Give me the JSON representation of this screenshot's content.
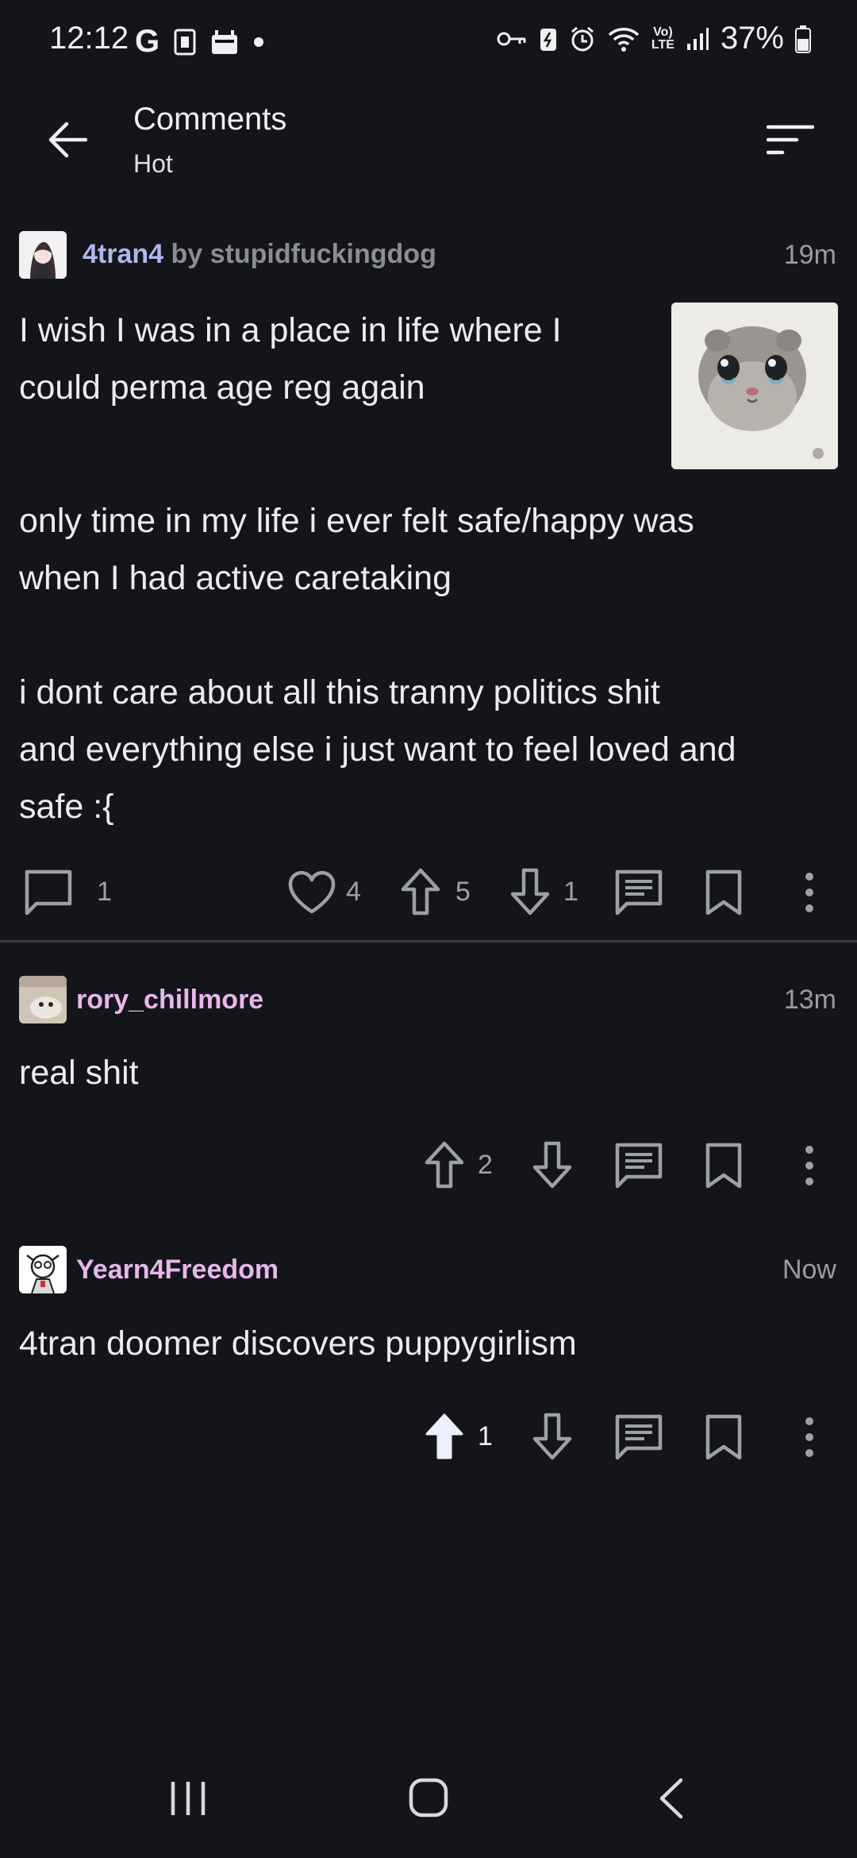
{
  "status_bar": {
    "time": "12:12",
    "battery": "37%"
  },
  "header": {
    "title": "Comments",
    "subtitle": "Hot"
  },
  "post": {
    "community": "4tran4",
    "by_label": "by",
    "author": "stupidfuckingdog",
    "time": "19m",
    "text_part1": "I wish I was in a place in life where I\ncould perma age reg again",
    "text_part2": "only time in my life i ever felt safe/happy was\nwhen I had active caretaking\n\ni dont care about all this tranny politics shit\nand everything else i just want to feel loved and\nsafe :{",
    "comments_count": "1",
    "likes_count": "4",
    "upvotes": "5",
    "downvotes": "1"
  },
  "comments": [
    {
      "username": "rory_chillmore",
      "time": "13m",
      "body": "real shit",
      "upvotes": "2"
    },
    {
      "username": "Yearn4Freedom",
      "time": "Now",
      "body": "4tran doomer discovers puppygirlism",
      "upvotes": "1"
    }
  ],
  "colors": {
    "background": "#14151a",
    "community": "#aeb8ea",
    "username": "#e7b8ea",
    "muted": "#9ea0a8"
  }
}
